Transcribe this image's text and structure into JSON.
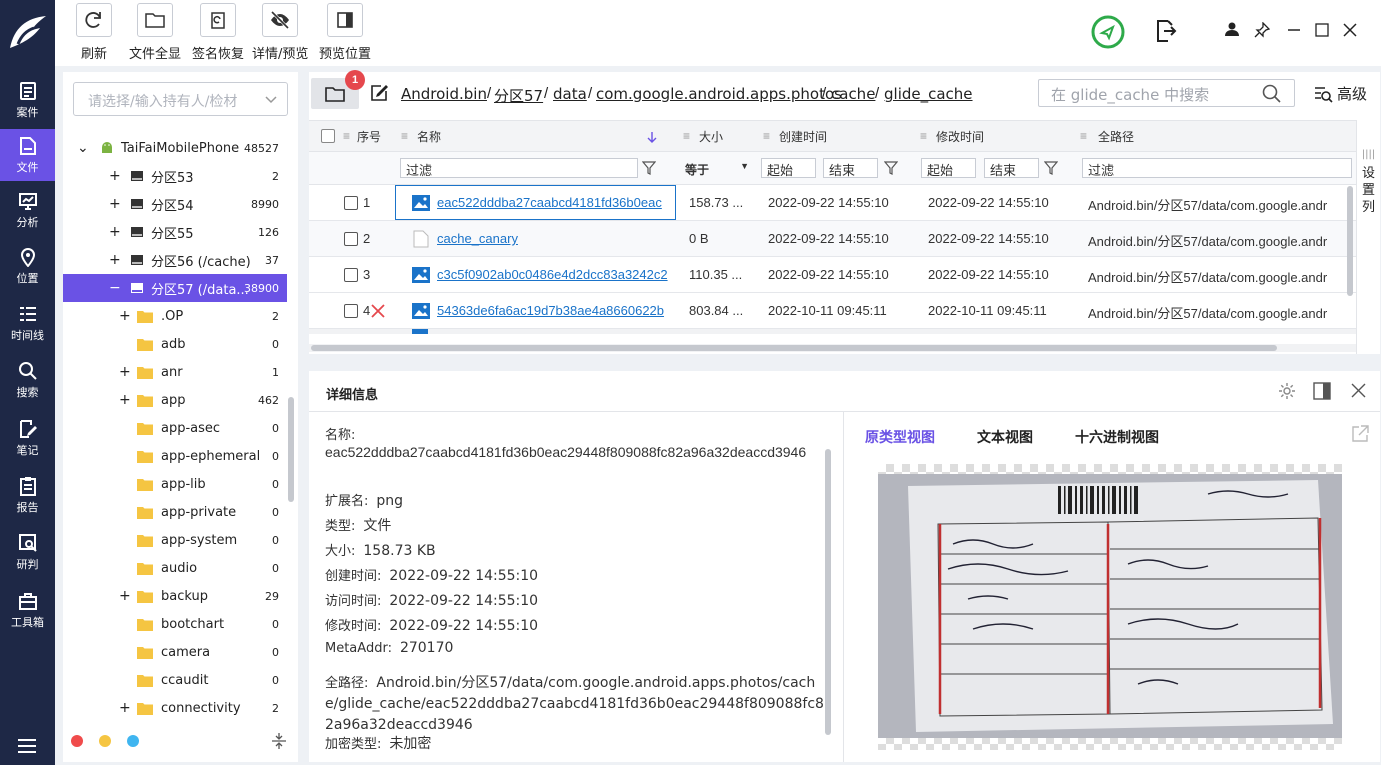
{
  "nav": {
    "items": [
      {
        "label": "案件",
        "icon": "case-icon"
      },
      {
        "label": "文件",
        "icon": "file-icon"
      },
      {
        "label": "分析",
        "icon": "analysis-icon"
      },
      {
        "label": "位置",
        "icon": "location-icon"
      },
      {
        "label": "时间线",
        "icon": "timeline-icon"
      },
      {
        "label": "搜索",
        "icon": "search-icon"
      },
      {
        "label": "笔记",
        "icon": "note-icon"
      },
      {
        "label": "报告",
        "icon": "report-icon"
      },
      {
        "label": "研判",
        "icon": "judgement-icon"
      },
      {
        "label": "工具箱",
        "icon": "toolbox-icon"
      }
    ],
    "active_index": 1
  },
  "toolbar": {
    "refresh": "刷新",
    "show_all": "文件全显",
    "sig_restore": "签名恢复",
    "detail_preview": "详情/预览",
    "preview_pos": "预览位置"
  },
  "tree": {
    "combo_placeholder": "请选择/输入持有人/检材",
    "device": {
      "name": "TaiFaiMobilePhone",
      "count": "48527"
    },
    "partitions": [
      {
        "name": "分区53",
        "count": "2"
      },
      {
        "name": "分区54",
        "count": "8990"
      },
      {
        "name": "分区55",
        "count": "126"
      },
      {
        "name": "分区56  (/cache)",
        "count": "37"
      },
      {
        "name": "分区57  (/data...",
        "count": "38900"
      }
    ],
    "folders": [
      {
        "name": ".OP",
        "count": "2",
        "expandable": true
      },
      {
        "name": "adb",
        "count": "0",
        "expandable": false
      },
      {
        "name": "anr",
        "count": "1",
        "expandable": true
      },
      {
        "name": "app",
        "count": "462",
        "expandable": true
      },
      {
        "name": "app-asec",
        "count": "0",
        "expandable": false
      },
      {
        "name": "app-ephemeral",
        "count": "0",
        "expandable": false
      },
      {
        "name": "app-lib",
        "count": "0",
        "expandable": false
      },
      {
        "name": "app-private",
        "count": "0",
        "expandable": false
      },
      {
        "name": "app-system",
        "count": "0",
        "expandable": false
      },
      {
        "name": "audio",
        "count": "0",
        "expandable": false
      },
      {
        "name": "backup",
        "count": "29",
        "expandable": true
      },
      {
        "name": "bootchart",
        "count": "0",
        "expandable": false
      },
      {
        "name": "camera",
        "count": "0",
        "expandable": false
      },
      {
        "name": "ccaudit",
        "count": "0",
        "expandable": false
      },
      {
        "name": "connectivity",
        "count": "2",
        "expandable": true
      }
    ]
  },
  "breadcrumb": {
    "badge": "1",
    "parts": [
      "Android.bin",
      "分区57",
      "data",
      "com.google.android.apps.photos",
      "cache",
      "glide_cache"
    ],
    "search_placeholder": "在 glide_cache 中搜索",
    "advanced": "高级"
  },
  "table": {
    "columns": {
      "seq": "序号",
      "name": "名称",
      "size": "大小",
      "created": "创建时间",
      "modified": "修改时间",
      "path": "全路径"
    },
    "filter": {
      "placeholder": "过滤",
      "equals": "等于",
      "start": "起始",
      "end": "结束"
    },
    "settings_col": "设置列",
    "rows": [
      {
        "seq": "1",
        "name": "eac522dddba27caabcd4181fd36b0eac",
        "size": "158.73 ...",
        "created": "2022-09-22 14:55:10",
        "modified": "2022-09-22 14:55:10",
        "path": "Android.bin/分区57/data/com.google.andr",
        "type": "image"
      },
      {
        "seq": "2",
        "name": "cache_canary",
        "size": "0 B",
        "created": "2022-09-22 14:55:10",
        "modified": "2022-09-22 14:55:10",
        "path": "Android.bin/分区57/data/com.google.andr",
        "type": "file"
      },
      {
        "seq": "3",
        "name": "c3c5f0902ab0c0486e4d2dcc83a3242c2",
        "size": "110.35 ...",
        "created": "2022-09-22 14:55:10",
        "modified": "2022-09-22 14:55:10",
        "path": "Android.bin/分区57/data/com.google.andr",
        "type": "image"
      },
      {
        "seq": "4",
        "name": "54363de6fa6ac19d7b38ae4a8660622b",
        "size": "803.84 ...",
        "created": "2022-10-11 09:45:11",
        "modified": "2022-10-11 09:45:11",
        "path": "Android.bin/分区57/data/com.google.andr",
        "type": "image",
        "deleted": true
      }
    ]
  },
  "detail": {
    "title": "详细信息",
    "name_label": "名称:",
    "name_value": "eac522dddba27caabcd4181fd36b0eac29448f809088fc82a96a32deaccd3946",
    "fields": [
      {
        "label": "扩展名:",
        "value": "png"
      },
      {
        "label": "类型:",
        "value": "文件"
      },
      {
        "label": "大小:",
        "value": "158.73 KB"
      },
      {
        "label": "创建时间:",
        "value": "2022-09-22 14:55:10"
      },
      {
        "label": "访问时间:",
        "value": "2022-09-22 14:55:10"
      },
      {
        "label": "修改时间:",
        "value": "2022-09-22 14:55:10"
      },
      {
        "label": "MetaAddr:",
        "value": "270170"
      }
    ],
    "path_label": "全路径:",
    "path_value": "Android.bin/分区57/data/com.google.android.apps.photos/cache/glide_cache/eac522dddba27caabcd4181fd36b0eac29448f809088fc82a96a32deaccd3946",
    "enc_label": "加密类型:",
    "enc_value": "未加密",
    "preview_tabs": [
      "原类型视图",
      "文本视图",
      "十六进制视图"
    ],
    "active_tab": 0
  },
  "colors": {
    "accent": "#6a52e5",
    "nav_bg": "#1e2846",
    "link": "#1a73c9"
  }
}
